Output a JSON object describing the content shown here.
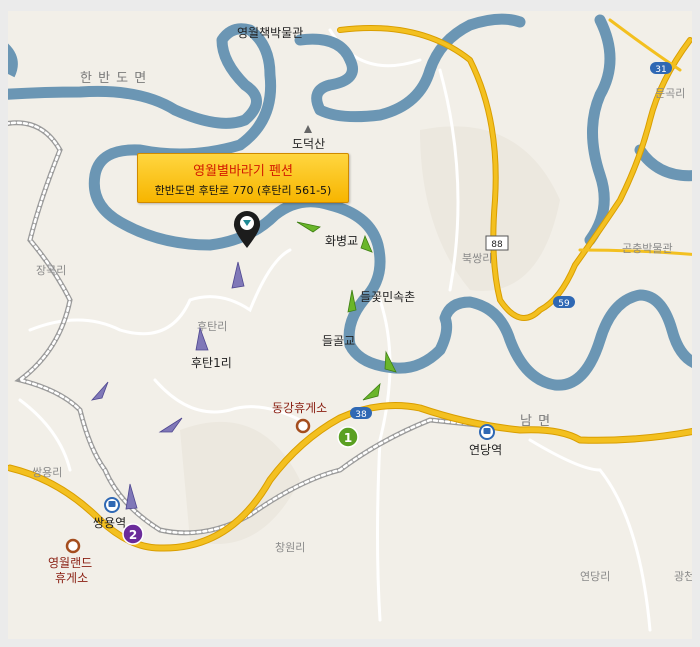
{
  "callout": {
    "title": "영월별바라기 펜션",
    "address": "한반도면 후탄로 770 (후탄리 561-5)"
  },
  "regions": {
    "hanbando": "한 반 도 면",
    "nam": "남 면"
  },
  "places": {
    "museum_yeongwol": "영월책박물관",
    "dodeoksan": "도덕산",
    "hwabyeonggyo": "화병교",
    "deulkkot": "들꽃민속촌",
    "deulgolgyo": "들골교",
    "hutan1ri": "후탄1리",
    "hutanri": "후탄리",
    "janggokri": "장곡리",
    "ssangyongri": "쌍용리",
    "changwonri": "창원리",
    "bukssangri": "북쌍리",
    "mungokri": "문곡리",
    "gonchung": "곤충박물관",
    "yeondangri": "연당리",
    "gwangcheon": "광천"
  },
  "pois": {
    "donggang_rest": "동강휴게소",
    "yeongwolland_rest_line1": "영월랜드",
    "yeongwolland_rest_line2": "휴게소"
  },
  "stations": {
    "ssangyong": "쌍용역",
    "yeondang": "연당역"
  },
  "route_shields": {
    "r38": "38",
    "r88": "88",
    "r59": "59",
    "r31": "31"
  },
  "markers": {
    "one": "1",
    "two": "2"
  },
  "colors": {
    "land": "#f2efe8",
    "water": "#6b96b4",
    "road_main": "#f3c020",
    "road_minor": "#ffffff",
    "railway": "#9a9a9a",
    "green_arrow": "#6ab62a",
    "purple_arrow": "#8078b8",
    "callout_bg": "#fbc81c",
    "callout_title": "#d21a00"
  }
}
